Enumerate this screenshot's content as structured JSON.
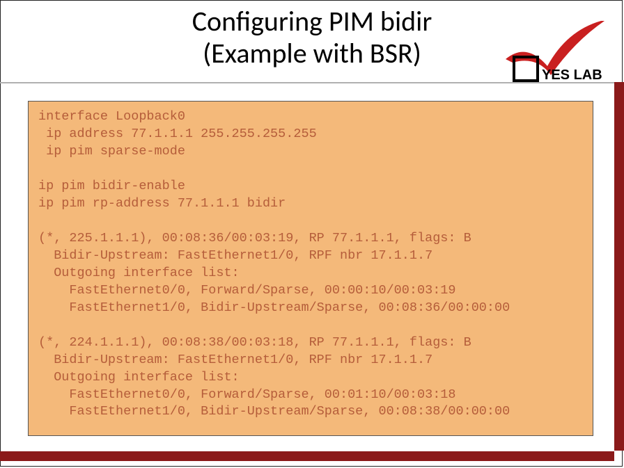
{
  "title_line1": "Configuring PIM bidir",
  "title_line2": "(Example with BSR)",
  "logo_text": "YES LAB",
  "code_lines": [
    "interface Loopback0",
    " ip address 77.1.1.1 255.255.255.255",
    " ip pim sparse-mode",
    "",
    "ip pim bidir-enable",
    "ip pim rp-address 77.1.1.1 bidir",
    "",
    "(*, 225.1.1.1), 00:08:36/00:03:19, RP 77.1.1.1, flags: B",
    "  Bidir-Upstream: FastEthernet1/0, RPF nbr 17.1.1.7",
    "  Outgoing interface list:",
    "    FastEthernet0/0, Forward/Sparse, 00:00:10/00:03:19",
    "    FastEthernet1/0, Bidir-Upstream/Sparse, 00:08:36/00:00:00",
    "",
    "(*, 224.1.1.1), 00:08:38/00:03:18, RP 77.1.1.1, flags: B",
    "  Bidir-Upstream: FastEthernet1/0, RPF nbr 17.1.1.7",
    "  Outgoing interface list:",
    "    FastEthernet0/0, Forward/Sparse, 00:01:10/00:03:18",
    "    FastEthernet1/0, Bidir-Upstream/Sparse, 00:08:38/00:00:00"
  ]
}
